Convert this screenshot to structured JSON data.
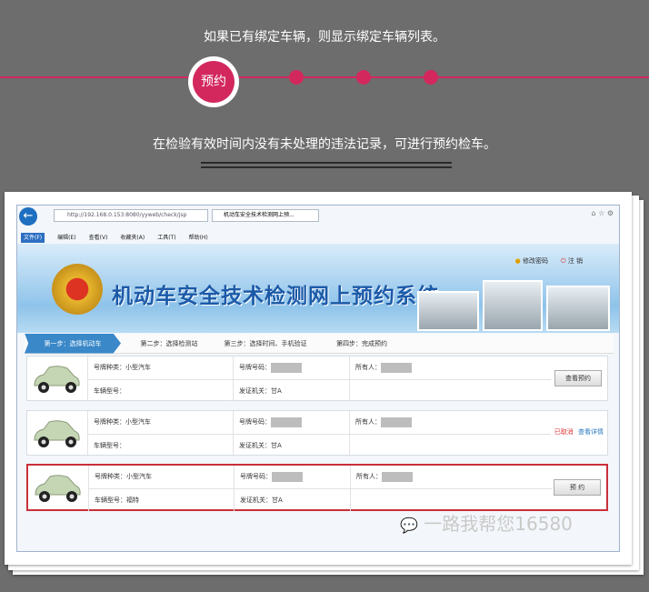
{
  "intro_text": "如果已有绑定车辆，则显示绑定车辆列表。",
  "step_badge": "预约",
  "note_text": "在检验有效时间内没有未处理的违法记录，可进行预约检车。",
  "browser": {
    "url": "http://192.168.0.153:8080/yyweb/check/jsp",
    "tab_title": "机动车安全技术检测网上预...",
    "menu": [
      "文件(F)",
      "编辑(E)",
      "查看(V)",
      "收藏夹(A)",
      "工具(T)",
      "帮助(H)"
    ]
  },
  "site": {
    "title": "机动车安全技术检测网上预约系统",
    "links": [
      "修改密码",
      "注 销"
    ]
  },
  "steps": [
    "第一步：选择机动车",
    "第二步：选择检测站",
    "第三步：选择时间、手机验证",
    "第四步：完成预约"
  ],
  "vehicles": [
    {
      "plate_type": "号牌种类：小型汽车",
      "plate_no": "号牌号码：",
      "owner": "所有人：",
      "model": "车辆型号：",
      "office": "发证机关：甘A",
      "action": "查看预约"
    },
    {
      "plate_type": "号牌种类：小型汽车",
      "plate_no": "号牌号码：",
      "owner": "所有人：",
      "model": "车辆型号：",
      "office": "发证机关：甘A",
      "status": "已取消",
      "detail": "查看详情"
    },
    {
      "plate_type": "号牌种类：小型汽车",
      "plate_no": "号牌号码：",
      "owner": "所有人：",
      "model": "车辆型号：福特",
      "office": "发证机关：甘A",
      "action": "预  约"
    }
  ],
  "watermark": "一路我帮您16580"
}
